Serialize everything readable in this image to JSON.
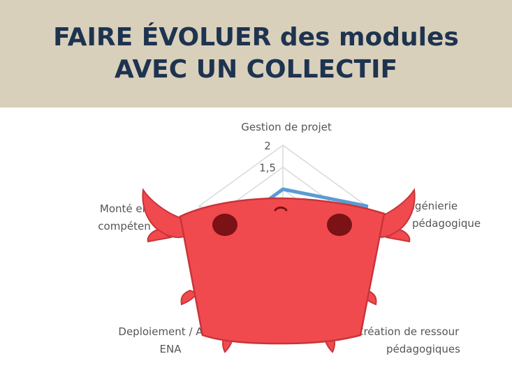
{
  "header": {
    "line1_bold": "FAIRE ÉVOLUER",
    "line1_rest": " des modules",
    "line2": "AVEC UN COLLECTIF"
  },
  "colors": {
    "header_bg": "#d9d0bb",
    "title": "#1e3350",
    "series": "#5b9bd5",
    "grid": "#d9d9d9",
    "mascot": "#f04a4f"
  },
  "mascot": {
    "icon": "crab-mascot-icon"
  },
  "chart_data": {
    "type": "radar",
    "axes": [
      "Gestion de projet",
      "Ingénierie pédagogique",
      "Création de ressources pédagogiques",
      "Deploiement / Administration ENA",
      "Montée en compétences"
    ],
    "axis_labels_visible": [
      [
        "Gestion de projet"
      ],
      [
        "Ingénierie",
        "pédagogique"
      ],
      [
        "Création de ressour",
        "pédagogiques"
      ],
      [
        "Deploiement / Admi",
        "ENA"
      ],
      [
        "Monté   en",
        "compéten"
      ]
    ],
    "ticks": [
      "2",
      "1,5"
    ],
    "rlim": [
      0,
      2
    ],
    "series": [
      {
        "values": [
          1,
          2,
          2,
          1,
          1
        ]
      }
    ]
  }
}
